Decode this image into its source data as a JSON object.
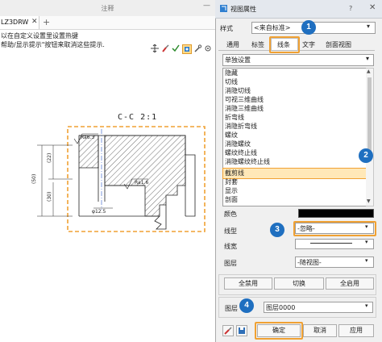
{
  "cad": {
    "panel_title": "注释",
    "doc_tab": "LZ3DRW",
    "messages": [
      "以在自定义设置里设置热键",
      "帮助/显示提示\"按钮来取消这些提示."
    ],
    "section_label": "C-C 2:1",
    "dims": {
      "d22": "(22)",
      "d30": "(30)",
      "d50": "(50)",
      "ra_top": "Ra6.3",
      "ra_mid": "Ra1.6",
      "dia": "φ12.5"
    }
  },
  "dialog": {
    "title": "视图属性",
    "style_label": "样式",
    "style_value": "<来自标准>",
    "tabs": [
      "通用",
      "标签",
      "线条",
      "文字",
      "剖面视图"
    ],
    "active_tab": "线条",
    "linetype_mode": "单独设置",
    "items": [
      "隐藏",
      "切线",
      "消隐切线",
      "可视三维曲线",
      "消隐三维曲线",
      "折弯线",
      "消隐折弯线",
      "螺纹",
      "消隐螺纹",
      "螺纹终止线",
      "消隐螺纹终止线",
      "截剪线",
      "封套",
      "显示",
      "剖面"
    ],
    "selected_item": "截剪线",
    "props": {
      "color_label": "颜色",
      "linetype_label": "线型",
      "linetype_value": "-忽略-",
      "linewidth_label": "线宽",
      "layer_label": "图层",
      "layer_value": "-随视图-"
    },
    "buttons": {
      "disable_all": "全禁用",
      "toggle": "切换",
      "enable_all": "全启用"
    },
    "layer2_label": "图层",
    "layer2_value": "图层0000",
    "footer": {
      "ok": "确定",
      "cancel": "取消",
      "apply": "应用"
    },
    "callouts": [
      "1",
      "2",
      "3",
      "4"
    ]
  },
  "colors": {
    "highlight": "#f0a133",
    "callout": "#1f6fc0"
  }
}
